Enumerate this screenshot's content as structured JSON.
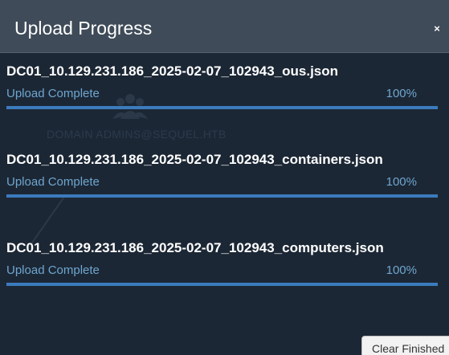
{
  "dialog": {
    "title": "Upload Progress",
    "close_label": "×"
  },
  "background": {
    "ghost_node_label": "DOMAIN ADMINS@SEQUEL.HTB"
  },
  "uploads": [
    {
      "filename": "DC01_10.129.231.186_2025-02-07_102943_ous.json",
      "status": "Upload Complete",
      "percent_text": "100%",
      "progress": 1.0
    },
    {
      "filename": "DC01_10.129.231.186_2025-02-07_102943_containers.json",
      "status": "Upload Complete",
      "percent_text": "100%",
      "progress": 1.0
    },
    {
      "filename": "DC01_10.129.231.186_2025-02-07_102943_computers.json",
      "status": "Upload Complete",
      "percent_text": "100%",
      "progress": 1.0
    }
  ],
  "footer": {
    "clear_label": "Clear Finished"
  },
  "colors": {
    "header_bg": "#3f4b58",
    "body_bg": "#1c2735",
    "status_text": "#6ea6cf",
    "progress_fill": "#3b7bbd"
  },
  "icons": {
    "ghost_node": "group-icon",
    "close": "close-icon"
  }
}
